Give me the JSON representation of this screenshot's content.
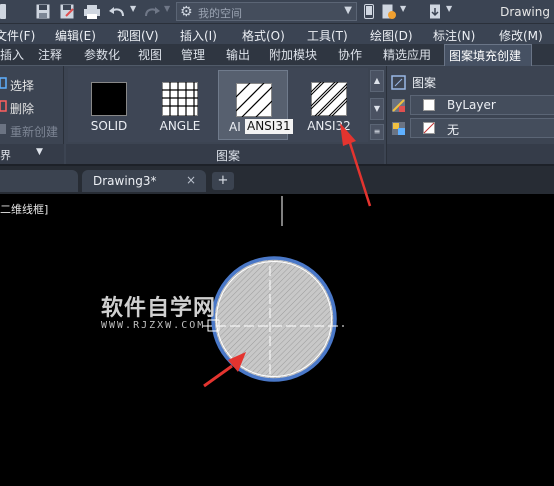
{
  "title_bar": {
    "workspace": "我的空间",
    "app_title": "Drawing"
  },
  "menu": [
    "文件(F)",
    "编辑(E)",
    "视图(V)",
    "插入(I)",
    "格式(O)",
    "工具(T)",
    "绘图(D)",
    "标注(N)",
    "修改(M)"
  ],
  "ribbon_tabs": [
    "插入",
    "注释",
    "参数化",
    "视图",
    "管理",
    "输出",
    "附加模块",
    "协作",
    "精选应用",
    "图案填充创建"
  ],
  "active_ribbon_tab": "图案填充创建",
  "boundary_panel": {
    "items": [
      "选择",
      "删除",
      "重新创建"
    ],
    "footer": "界"
  },
  "pattern_panel": {
    "patterns": [
      "SOLID",
      "ANGLE",
      "ANSI31",
      "ANSI32"
    ],
    "selected_pattern": "ANSI31",
    "tooltip": "ANSI31",
    "selected_label_prefix": "AI",
    "footer": "图案"
  },
  "properties_panel": {
    "type": "图案",
    "color": "ByLayer",
    "background": "无"
  },
  "doc_tabs": {
    "active": "Drawing3*",
    "close_symbol": "×",
    "new_tab_symbol": "+"
  },
  "canvas": {
    "viewport_label": "二维线框]"
  },
  "watermark": {
    "main": "软件自学网",
    "sub": "WWW.RJZXW.COM"
  },
  "colors": {
    "ribbon_bg": "#3c4452",
    "canvas_bg": "#000000",
    "hatch_boundary": "#4a78c8",
    "annotation_arrow": "#e4342f"
  }
}
